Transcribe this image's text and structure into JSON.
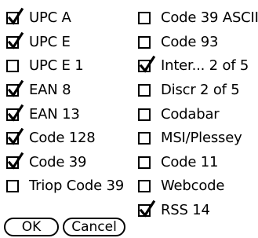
{
  "left_column": [
    {
      "label": "UPC A",
      "checked": true
    },
    {
      "label": "UPC E",
      "checked": true
    },
    {
      "label": "UPC E 1",
      "checked": false
    },
    {
      "label": "EAN 8",
      "checked": true
    },
    {
      "label": "EAN 13",
      "checked": true
    },
    {
      "label": "Code 128",
      "checked": true
    },
    {
      "label": "Code 39",
      "checked": true
    },
    {
      "label": "Triop Code 39",
      "checked": false
    }
  ],
  "right_column": [
    {
      "label": "Code 39 ASCII",
      "checked": false
    },
    {
      "label": "Code 93",
      "checked": false
    },
    {
      "label": "Inter... 2 of 5",
      "checked": true
    },
    {
      "label": "Discr 2 of 5",
      "checked": false
    },
    {
      "label": "Codabar",
      "checked": false
    },
    {
      "label": "MSI/Plessey",
      "checked": false
    },
    {
      "label": "Code 11",
      "checked": false
    },
    {
      "label": "Webcode",
      "checked": false
    },
    {
      "label": "RSS 14",
      "checked": true
    }
  ],
  "buttons": {
    "ok_label": "OK",
    "cancel_label": "Cancel"
  }
}
